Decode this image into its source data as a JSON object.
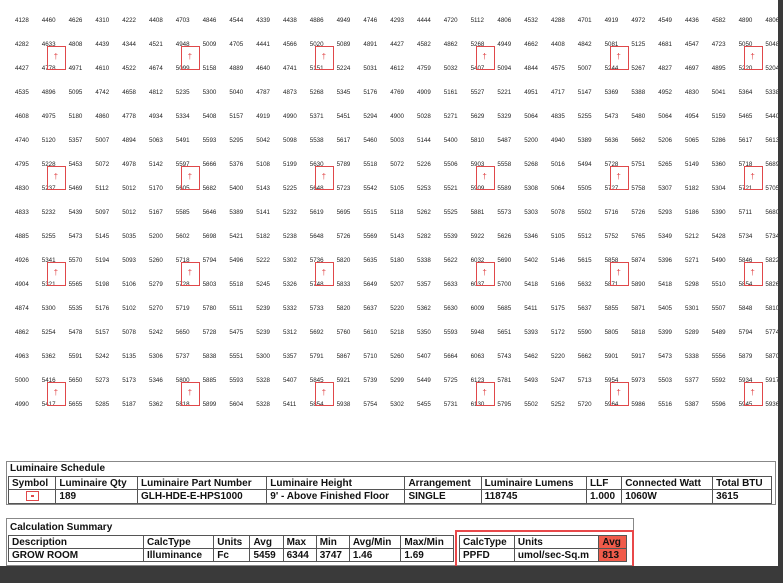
{
  "grid": {
    "rows": [
      [
        "4128",
        "4460",
        "4626",
        "4310",
        "4222",
        "4408",
        "4703",
        "4846",
        "4544",
        "4339",
        "4438",
        "4886",
        "4949",
        "4746",
        "4293",
        "4444",
        "4720",
        "5112",
        "4806",
        "4532",
        "4288",
        "4701",
        "4919",
        "4972",
        "4549",
        "4436",
        "4582",
        "4890",
        "4806"
      ],
      [
        "4282",
        "4633",
        "4808",
        "4439",
        "4344",
        "4521",
        "4948",
        "5009",
        "4705",
        "4441",
        "4566",
        "5020",
        "5089",
        "4891",
        "4427",
        "4582",
        "4862",
        "5268",
        "4949",
        "4662",
        "4408",
        "4842",
        "5081",
        "5125",
        "4681",
        "4547",
        "4723",
        "5050",
        "5048"
      ],
      [
        "4427",
        "4778",
        "4971",
        "4610",
        "4522",
        "4674",
        "5099",
        "5158",
        "4889",
        "4640",
        "4741",
        "5151",
        "5224",
        "5031",
        "4612",
        "4759",
        "5032",
        "5407",
        "5094",
        "4844",
        "4575",
        "5007",
        "5244",
        "5267",
        "4827",
        "4697",
        "4895",
        "5220",
        "5204"
      ],
      [
        "4535",
        "4896",
        "5095",
        "4742",
        "4658",
        "4812",
        "5235",
        "5300",
        "5040",
        "4787",
        "4873",
        "5268",
        "5345",
        "5176",
        "4769",
        "4909",
        "5161",
        "5527",
        "5221",
        "4951",
        "4717",
        "5147",
        "5369",
        "5388",
        "4952",
        "4830",
        "5041",
        "5364",
        "5338"
      ],
      [
        "4608",
        "4975",
        "5180",
        "4860",
        "4778",
        "4934",
        "5334",
        "5408",
        "5157",
        "4919",
        "4990",
        "5371",
        "5451",
        "5294",
        "4900",
        "5028",
        "5271",
        "5629",
        "5329",
        "5064",
        "4835",
        "5255",
        "5473",
        "5480",
        "5064",
        "4954",
        "5159",
        "5465",
        "5440"
      ],
      [
        "4740",
        "5120",
        "5357",
        "5007",
        "4894",
        "5063",
        "5491",
        "5593",
        "5295",
        "5042",
        "5098",
        "5538",
        "5617",
        "5460",
        "5003",
        "5144",
        "5400",
        "5810",
        "5487",
        "5200",
        "4940",
        "5389",
        "5636",
        "5662",
        "5206",
        "5065",
        "5286",
        "5617",
        "5613"
      ],
      [
        "4795",
        "5228",
        "5453",
        "5072",
        "4978",
        "5142",
        "5597",
        "5666",
        "5376",
        "5108",
        "5199",
        "5630",
        "5789",
        "5518",
        "5072",
        "5226",
        "5506",
        "5903",
        "5558",
        "5268",
        "5016",
        "5494",
        "5728",
        "5751",
        "5265",
        "5149",
        "5360",
        "5718",
        "5689"
      ],
      [
        "4830",
        "5237",
        "5469",
        "5112",
        "5012",
        "5170",
        "5605",
        "5682",
        "5400",
        "5143",
        "5225",
        "5648",
        "5723",
        "5542",
        "5105",
        "5253",
        "5521",
        "5909",
        "5589",
        "5308",
        "5064",
        "5505",
        "5727",
        "5758",
        "5307",
        "5182",
        "5304",
        "5721",
        "5705"
      ],
      [
        "4833",
        "5232",
        "5439",
        "5097",
        "5012",
        "5167",
        "5585",
        "5646",
        "5389",
        "5141",
        "5232",
        "5619",
        "5695",
        "5515",
        "5118",
        "5262",
        "5525",
        "5881",
        "5573",
        "5303",
        "5078",
        "5502",
        "5716",
        "5726",
        "5293",
        "5186",
        "5390",
        "5711",
        "5680"
      ],
      [
        "4885",
        "5255",
        "5473",
        "5145",
        "5035",
        "5200",
        "5602",
        "5698",
        "5421",
        "5182",
        "5238",
        "5648",
        "5726",
        "5569",
        "5143",
        "5282",
        "5539",
        "5922",
        "5626",
        "5346",
        "5105",
        "5512",
        "5752",
        "5765",
        "5349",
        "5212",
        "5428",
        "5734",
        "5734"
      ],
      [
        "4926",
        "5341",
        "5570",
        "5194",
        "5093",
        "5260",
        "5718",
        "5794",
        "5496",
        "5222",
        "5302",
        "5736",
        "5820",
        "5635",
        "5180",
        "5338",
        "5622",
        "6032",
        "5690",
        "5402",
        "5146",
        "5615",
        "5858",
        "5874",
        "5396",
        "5271",
        "5490",
        "5846",
        "5822"
      ],
      [
        "4904",
        "5321",
        "5565",
        "5198",
        "5106",
        "5279",
        "5728",
        "5803",
        "5518",
        "5245",
        "5326",
        "5748",
        "5833",
        "5649",
        "5207",
        "5357",
        "5633",
        "6037",
        "5700",
        "5418",
        "5166",
        "5632",
        "5871",
        "5890",
        "5418",
        "5298",
        "5510",
        "5854",
        "5826"
      ],
      [
        "4874",
        "5300",
        "5535",
        "5176",
        "5102",
        "5270",
        "5719",
        "5780",
        "5511",
        "5239",
        "5332",
        "5733",
        "5820",
        "5637",
        "5220",
        "5362",
        "5630",
        "6009",
        "5685",
        "5411",
        "5175",
        "5637",
        "5855",
        "5871",
        "5405",
        "5301",
        "5507",
        "5848",
        "5810"
      ],
      [
        "4862",
        "5254",
        "5478",
        "5157",
        "5078",
        "5242",
        "5650",
        "5728",
        "5475",
        "5239",
        "5312",
        "5692",
        "5760",
        "5610",
        "5218",
        "5350",
        "5593",
        "5948",
        "5651",
        "5393",
        "5172",
        "5590",
        "5805",
        "5818",
        "5399",
        "5289",
        "5489",
        "5794",
        "5774"
      ],
      [
        "4963",
        "5362",
        "5591",
        "5242",
        "5135",
        "5306",
        "5737",
        "5838",
        "5551",
        "5300",
        "5357",
        "5791",
        "5867",
        "5710",
        "5260",
        "5407",
        "5664",
        "6063",
        "5743",
        "5462",
        "5220",
        "5662",
        "5901",
        "5917",
        "5473",
        "5338",
        "5556",
        "5879",
        "5870"
      ],
      [
        "5000",
        "5416",
        "5650",
        "5273",
        "5173",
        "5346",
        "5800",
        "5885",
        "5593",
        "5328",
        "5407",
        "5845",
        "5921",
        "5739",
        "5299",
        "5449",
        "5725",
        "6123",
        "5781",
        "5493",
        "5247",
        "5713",
        "5954",
        "5973",
        "5503",
        "5377",
        "5592",
        "5934",
        "5917"
      ],
      [
        "4990",
        "5417",
        "5655",
        "5285",
        "5187",
        "5362",
        "5818",
        "5899",
        "5604",
        "5328",
        "5411",
        "5854",
        "5938",
        "5754",
        "5302",
        "5455",
        "5731",
        "6130",
        "5795",
        "5502",
        "5252",
        "5720",
        "5964",
        "5986",
        "5516",
        "5387",
        "5596",
        "5945",
        "5936"
      ]
    ]
  },
  "luminaire_schedule": {
    "title": "Luminaire Schedule",
    "headers": [
      "Symbol",
      "Luminaire Qty",
      "Luminaire Part Number",
      "Luminaire Height",
      "Arrangement",
      "Luminaire Lumens",
      "LLF",
      "Connected Watt",
      "Total BTU"
    ],
    "values": [
      "189",
      "GLH-HDE-E-HPS1000",
      "9' - Above Finished Floor",
      "SINGLE",
      "118745",
      "1.000",
      "1060W",
      "3615"
    ]
  },
  "calculation_summary": {
    "title": "Calculation Summary",
    "headers": [
      "Description",
      "CalcType",
      "Units",
      "Avg",
      "Max",
      "Min",
      "Avg/Min",
      "Max/Min"
    ],
    "values": [
      "GROW ROOM",
      "Illuminance",
      "Fc",
      "5459",
      "6344",
      "3747",
      "1.46",
      "1.69"
    ],
    "ppfd_headers": [
      "CalcType",
      "Units",
      "Avg"
    ],
    "ppfd_values": [
      "PPFD",
      "umol/sec-Sq.m",
      "813"
    ]
  },
  "colors": {
    "fixture": "#e0484a",
    "highlight": "#f05b4a",
    "background": "#3a3a3a"
  }
}
